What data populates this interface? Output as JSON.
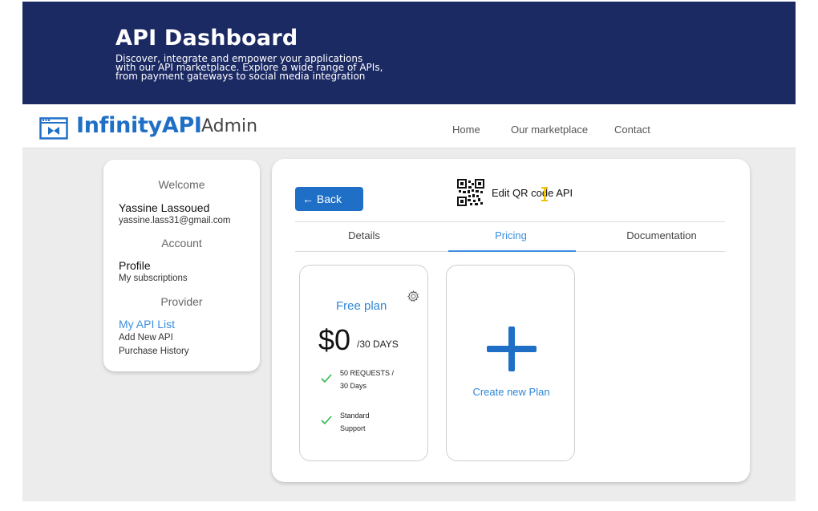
{
  "hero": {
    "title": "API Dashboard",
    "line1": "Discover, integrate and empower your applications",
    "line2": "with our API marketplace. Explore a wide range of APIs,",
    "line3": "from payment gateways to social media integration"
  },
  "navbar": {
    "logo_icon": "api-window-icon",
    "logo_text": "InfinityAPI",
    "logo_suffix": "Admin",
    "links": [
      "Home",
      "Our marketplace",
      "Contact"
    ]
  },
  "sidebar": {
    "welcome_heading": "Welcome",
    "user_name": "Yassine Lassoued",
    "user_email": "yassine.lass31@gmail.com",
    "account_heading": "Account",
    "profile_label": "Profile",
    "subscriptions_label": "My subscriptions",
    "provider_heading": "Provider",
    "api_list_label": "My API List",
    "add_api_label": "Add New API",
    "purchase_history_label": "Purchase History"
  },
  "panel": {
    "back_label": "← Back",
    "api_icon": "qr-code-icon",
    "api_title": "Edit QR code API",
    "tabs": [
      "Details",
      "Pricing",
      "Documentation"
    ],
    "active_tab": "Pricing"
  },
  "plans": [
    {
      "name": "Free plan",
      "price": "$0",
      "period": "/30 DAYS",
      "feature1_line1": "50 REQUESTS /",
      "feature1_line2": "30 Days",
      "feature2_line1": "Standard",
      "feature2_line2": "Support"
    }
  ],
  "create_plan_label": "Create new Plan",
  "colors": {
    "hero_bg": "#1c2a64",
    "brand_blue": "#1f6fc7",
    "link_blue": "#3b8fe0",
    "check_green": "#2fb84a"
  }
}
